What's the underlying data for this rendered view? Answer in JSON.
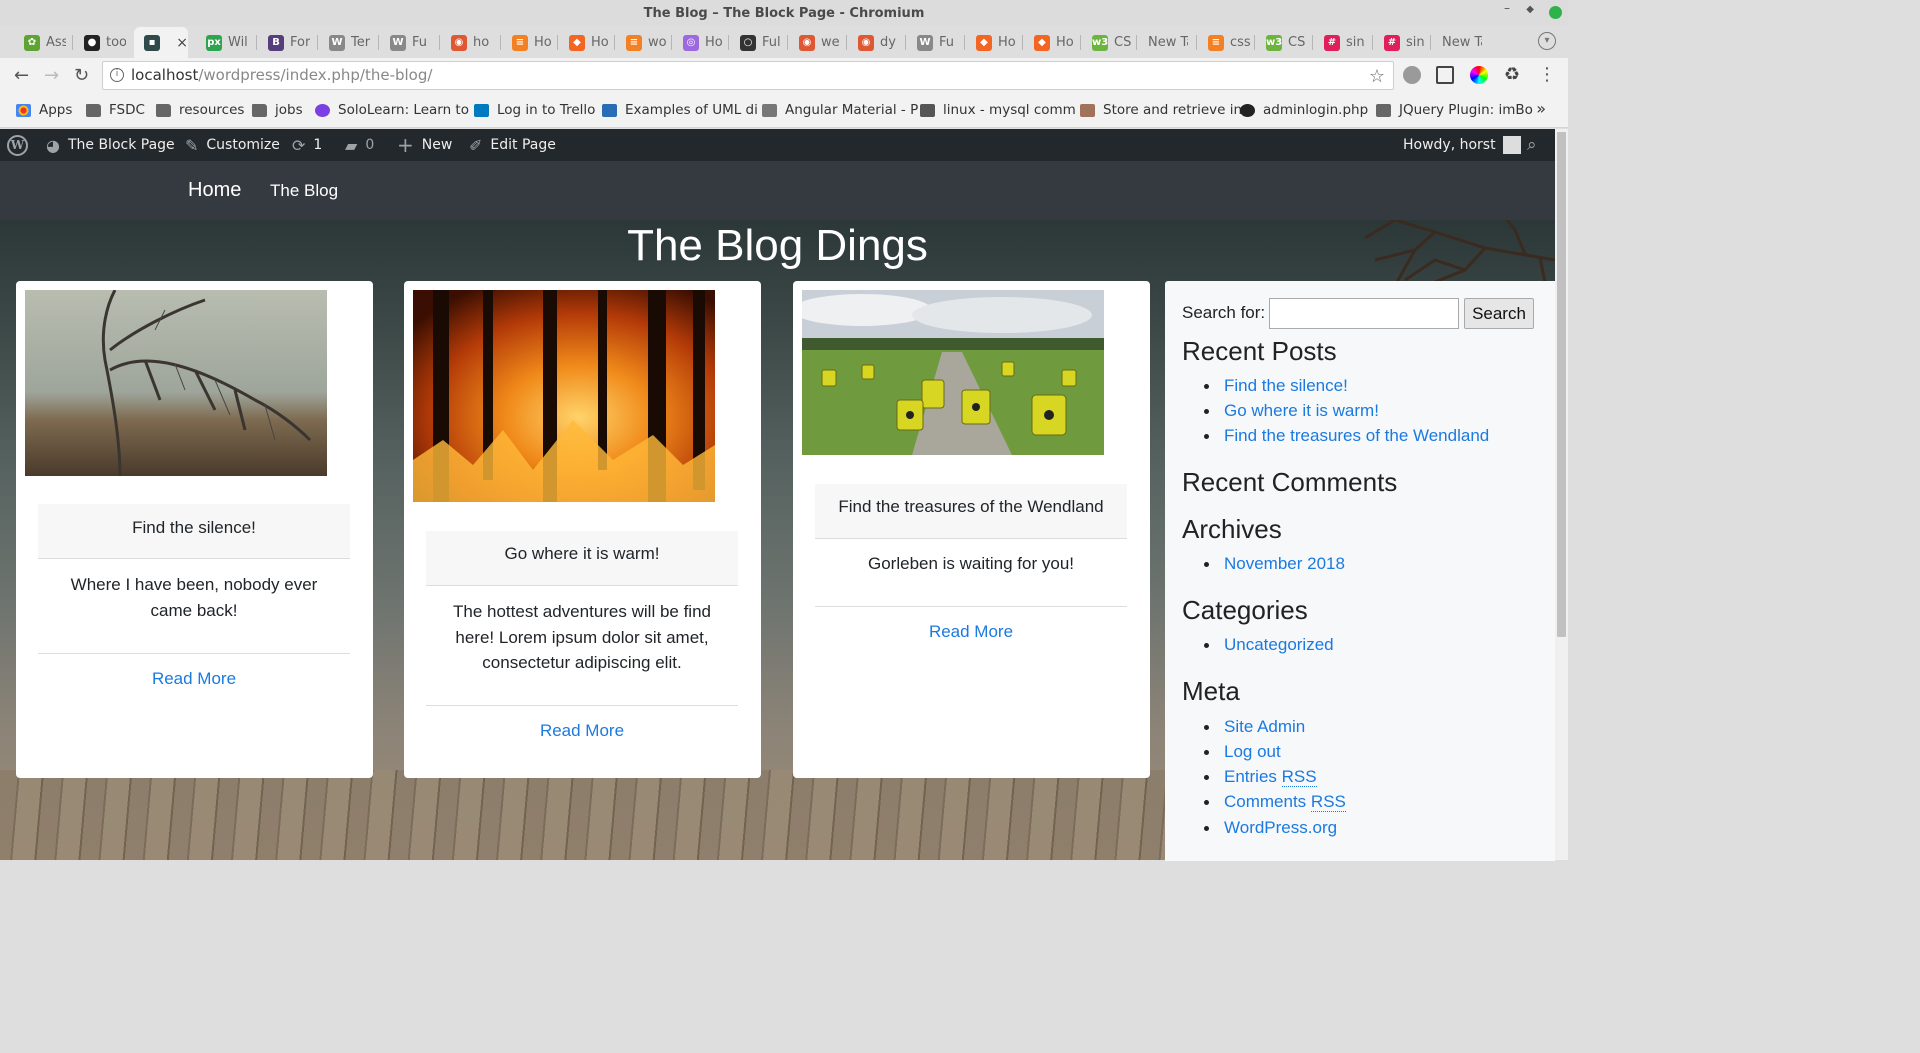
{
  "window": {
    "title": "The Blog – The Block Page - Chromium"
  },
  "tabs": [
    {
      "label": "Ass",
      "color": "#5fa334",
      "glyph": "✿"
    },
    {
      "label": "too",
      "color": "#222222",
      "glyph": "●"
    },
    {
      "label": "",
      "color": "#2e4a4a",
      "glyph": "▪",
      "active": true
    },
    {
      "label": "Wil",
      "color": "#2ea44f",
      "glyph": "px"
    },
    {
      "label": "For",
      "color": "#563d7c",
      "glyph": "B"
    },
    {
      "label": "Ter",
      "color": "#888888",
      "glyph": "W"
    },
    {
      "label": "Fu",
      "color": "#888888",
      "glyph": "W"
    },
    {
      "label": "ho",
      "color": "#de5833",
      "glyph": "◉"
    },
    {
      "label": "Ho",
      "color": "#f48024",
      "glyph": "≡"
    },
    {
      "label": "Ho",
      "color": "#f26522",
      "glyph": "◆"
    },
    {
      "label": "wo",
      "color": "#f48024",
      "glyph": "≡"
    },
    {
      "label": "Ho",
      "color": "#9c6ade",
      "glyph": "◎"
    },
    {
      "label": "Ful",
      "color": "#333333",
      "glyph": "○"
    },
    {
      "label": "we",
      "color": "#de5833",
      "glyph": "◉"
    },
    {
      "label": "dy",
      "color": "#de5833",
      "glyph": "◉"
    },
    {
      "label": "Fu",
      "color": "#888888",
      "glyph": "W"
    },
    {
      "label": "Ho",
      "color": "#f26522",
      "glyph": "◆"
    },
    {
      "label": "Ho",
      "color": "#f26522",
      "glyph": "◆"
    },
    {
      "label": "CS",
      "color": "#6db33f",
      "glyph": "w3"
    },
    {
      "label": "New Ta",
      "color": "",
      "glyph": ""
    },
    {
      "label": "css",
      "color": "#f48024",
      "glyph": "≡"
    },
    {
      "label": "CS",
      "color": "#6db33f",
      "glyph": "w3"
    },
    {
      "label": "sin",
      "color": "#e01e5a",
      "glyph": "#"
    },
    {
      "label": "sin",
      "color": "#e01e5a",
      "glyph": "#"
    },
    {
      "label": "New Ta",
      "color": "",
      "glyph": ""
    }
  ],
  "address": {
    "host": "localhost",
    "path": "/wordpress/index.php/the-blog/"
  },
  "bookmarks": [
    {
      "label": "Apps",
      "icon": "apps"
    },
    {
      "label": "FSDC",
      "icon": "folder"
    },
    {
      "label": "resources",
      "icon": "folder"
    },
    {
      "label": "jobs",
      "icon": "folder"
    },
    {
      "label": "SoloLearn: Learn to",
      "icon": "sololearn"
    },
    {
      "label": "Log in to Trello",
      "icon": "trello"
    },
    {
      "label": "Examples of UML di",
      "icon": "uml"
    },
    {
      "label": "Angular Material - P",
      "icon": "stack"
    },
    {
      "label": "linux - mysql comm",
      "icon": "linux"
    },
    {
      "label": "Store and retrieve in",
      "icon": "user"
    },
    {
      "label": "adminlogin.php",
      "icon": "github"
    },
    {
      "label": "JQuery Plugin: imBo",
      "icon": "plugin"
    }
  ],
  "adminbar": {
    "site": "The Block Page",
    "customize": "Customize",
    "updates": "1",
    "comments": "0",
    "new": "New",
    "edit": "Edit Page",
    "howdy": "Howdy, horst"
  },
  "nav": {
    "home": "Home",
    "blog": "The Blog"
  },
  "page": {
    "heading": "The Blog Dings"
  },
  "posts": [
    {
      "title": "Find the silence!",
      "excerpt": "Where I have been, nobody ever came back!",
      "more": "Read More",
      "image": "foggy-tree"
    },
    {
      "title": "Go where it is warm!",
      "excerpt": "The hottest adventures will be find here! Lorem ipsum dolor sit amet, consectetur adipiscing elit.",
      "more": "Read More",
      "image": "forest-fire"
    },
    {
      "title": "Find the treasures of the Wendland",
      "excerpt": "Gorleben is waiting for you!",
      "more": "Read More",
      "image": "nuclear-barrels-field"
    }
  ],
  "sidebar": {
    "search_label": "Search for:",
    "search_value": "",
    "search_button": "Search",
    "recent_posts_heading": "Recent Posts",
    "recent_posts": [
      "Find the silence!",
      "Go where it is warm!",
      "Find the treasures of the Wendland"
    ],
    "recent_comments_heading": "Recent Comments",
    "archives_heading": "Archives",
    "archives": [
      "November 2018"
    ],
    "categories_heading": "Categories",
    "categories": [
      "Uncategorized"
    ],
    "meta_heading": "Meta",
    "meta": {
      "site_admin": "Site Admin",
      "logout": "Log out",
      "entries": "Entries ",
      "comments": "Comments ",
      "rss": "RSS",
      "wordpress": "WordPress.org"
    }
  },
  "colors": {
    "link": "#1b7ae0",
    "adminbar": "#23282d",
    "navbar": "#343a40"
  }
}
